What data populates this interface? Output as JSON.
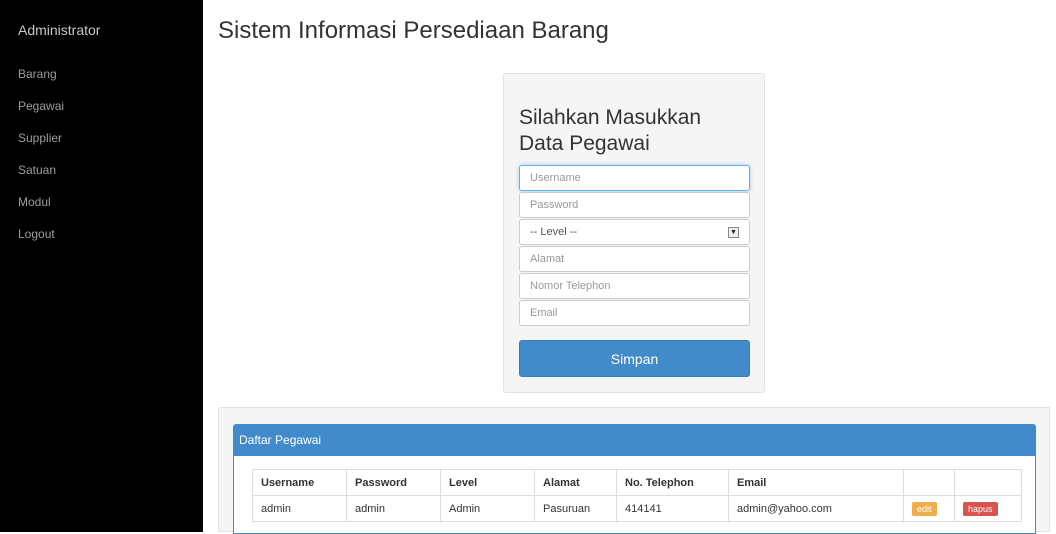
{
  "sidebar": {
    "brand": "Administrator",
    "items": [
      {
        "label": "Barang"
      },
      {
        "label": "Pegawai"
      },
      {
        "label": "Supplier"
      },
      {
        "label": "Satuan"
      },
      {
        "label": "Modul"
      },
      {
        "label": "Logout"
      }
    ]
  },
  "page": {
    "title": "Sistem Informasi Persediaan Barang"
  },
  "form": {
    "heading_line1": "Silahkan Masukkan",
    "heading_line2": "Data Pegawai",
    "username": {
      "placeholder": "Username",
      "value": ""
    },
    "password": {
      "placeholder": "Password",
      "value": ""
    },
    "level": {
      "selected": "-- Level --"
    },
    "alamat": {
      "placeholder": "Alamat",
      "value": ""
    },
    "telephon": {
      "placeholder": "Nomor Telephon",
      "value": ""
    },
    "email": {
      "placeholder": "Email",
      "value": ""
    },
    "save_label": "Simpan"
  },
  "list": {
    "title": "Daftar Pegawai",
    "columns": [
      "Username",
      "Password",
      "Level",
      "Alamat",
      "No. Telephon",
      "Email",
      "",
      ""
    ],
    "rows": [
      {
        "username": "admin",
        "password": "admin",
        "level": "Admin",
        "alamat": "Pasuruan",
        "telephon": "414141",
        "email": "admin@yahoo.com",
        "edit_label": "edit",
        "delete_label": "hapus"
      }
    ]
  },
  "colors": {
    "sidebar_bg": "#000000",
    "primary": "#428bca",
    "edit": "#f0ad4e",
    "delete": "#d9534f"
  },
  "icons": {
    "select_arrow": "chevron-down-icon"
  }
}
